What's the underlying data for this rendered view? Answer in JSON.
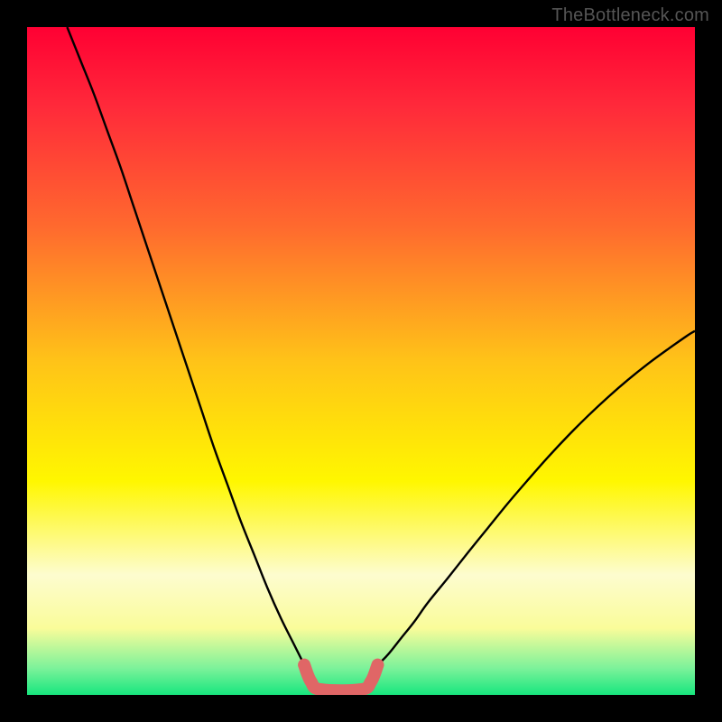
{
  "attribution": "TheBottleneck.com",
  "chart_data": {
    "type": "line",
    "title": "",
    "xlabel": "",
    "ylabel": "",
    "xlim": [
      0,
      100
    ],
    "ylim": [
      0,
      100
    ],
    "gradient_stops": [
      {
        "offset": 0,
        "color": "#ff0033"
      },
      {
        "offset": 12,
        "color": "#ff2a3a"
      },
      {
        "offset": 30,
        "color": "#ff6a2e"
      },
      {
        "offset": 50,
        "color": "#ffc318"
      },
      {
        "offset": 68,
        "color": "#fff700"
      },
      {
        "offset": 82,
        "color": "#fdfccf"
      },
      {
        "offset": 90,
        "color": "#fafc9a"
      },
      {
        "offset": 96,
        "color": "#7cf29a"
      },
      {
        "offset": 100,
        "color": "#17e67e"
      }
    ],
    "series": [
      {
        "name": "left-curve",
        "stroke": "#000000",
        "stroke_width": 2.4,
        "x": [
          6,
          8,
          10,
          12,
          14,
          16,
          18,
          20,
          22,
          24,
          26,
          28,
          30,
          32,
          34,
          36,
          38,
          40,
          41.5
        ],
        "y": [
          100,
          95,
          90,
          84.5,
          79,
          73,
          67,
          61,
          55,
          49,
          43,
          37,
          31.5,
          26,
          21,
          16,
          11.5,
          7.5,
          4.5
        ]
      },
      {
        "name": "right-curve",
        "stroke": "#000000",
        "stroke_width": 2.4,
        "x": [
          52.5,
          54,
          56,
          58,
          60,
          63,
          66,
          69,
          72,
          75,
          78,
          81,
          84,
          87,
          90,
          93,
          96,
          99,
          100
        ],
        "y": [
          4.5,
          6,
          8.5,
          11,
          13.8,
          17.5,
          21.3,
          25,
          28.7,
          32.2,
          35.6,
          38.8,
          41.8,
          44.6,
          47.2,
          49.6,
          51.8,
          53.9,
          54.5
        ]
      },
      {
        "name": "bottom-lip",
        "stroke": "#e06666",
        "stroke_width": 14,
        "linecap": "round",
        "x": [
          41.5,
          42.5,
          44,
          50,
          51.5,
          52.5
        ],
        "y": [
          4.5,
          2.0,
          0.8,
          0.8,
          2.0,
          4.5
        ]
      }
    ]
  }
}
